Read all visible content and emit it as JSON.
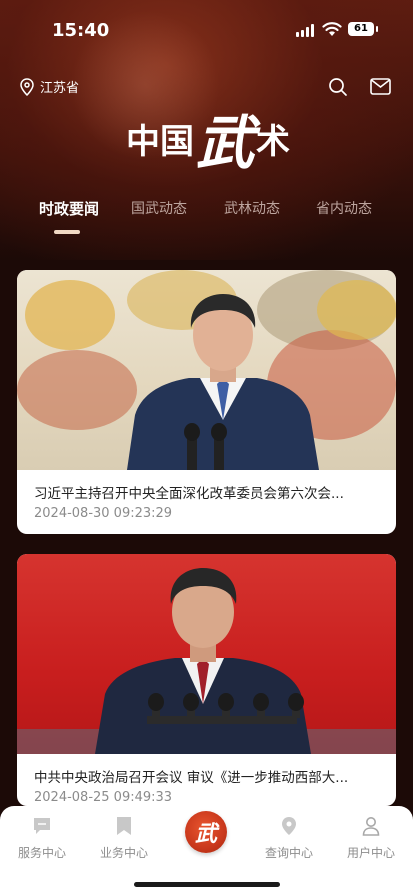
{
  "status_bar": {
    "time": "15:40",
    "battery": "61"
  },
  "header": {
    "location": "江苏省",
    "logo": {
      "c1": "中",
      "c2": "国",
      "c3": "武",
      "c4": "术"
    }
  },
  "tabs": [
    {
      "label": "时政要闻",
      "active": true
    },
    {
      "label": "国武动态",
      "active": false
    },
    {
      "label": "武林动态",
      "active": false
    },
    {
      "label": "省内动态",
      "active": false
    }
  ],
  "news": [
    {
      "title": "习近平主持召开中央全面深化改革委员会第六次会...",
      "date": "2024-08-30  09:23:29"
    },
    {
      "title": "中共中央政治局召开会议 审议《进一步推动西部大...",
      "date": "2024-08-25  09:49:33"
    }
  ],
  "bottom_nav": {
    "items": [
      {
        "label": "服务中心",
        "icon": "message-icon"
      },
      {
        "label": "业务中心",
        "icon": "bookmark-icon"
      },
      {
        "label": "查询中心",
        "icon": "map-pin-icon"
      },
      {
        "label": "用户中心",
        "icon": "user-icon"
      }
    ],
    "center_glyph": "武"
  },
  "colors": {
    "brand_dark": "#3d120b",
    "accent_red": "#c9381c"
  }
}
